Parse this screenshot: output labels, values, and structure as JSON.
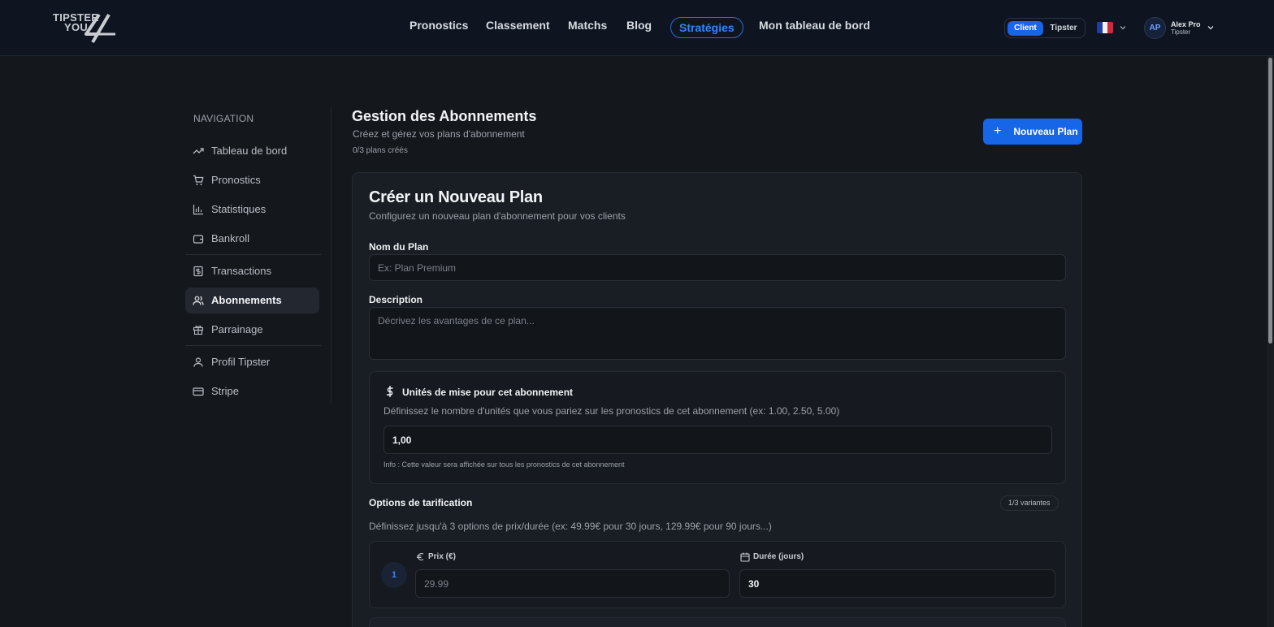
{
  "header": {
    "logo_line1": "TIPSTER",
    "logo_line2": "YOU",
    "nav": [
      "Pronostics",
      "Classement",
      "Matchs",
      "Blog",
      "Stratégies",
      "Mon tableau de bord"
    ],
    "active_nav": "Stratégies",
    "toggle": {
      "client": "Client",
      "tipster": "Tipster",
      "selected": "Client"
    },
    "language_flag": "fr",
    "user": {
      "initials": "AP",
      "name": "Alex Pro",
      "role": "Tipster"
    }
  },
  "sidebar": {
    "title": "NAVIGATION",
    "items": [
      {
        "label": "Tableau de bord",
        "icon": "trending-up-icon"
      },
      {
        "label": "Pronostics",
        "icon": "cart-icon"
      },
      {
        "label": "Statistiques",
        "icon": "bar-chart-icon"
      },
      {
        "label": "Bankroll",
        "icon": "wallet-icon"
      },
      {
        "label": "Transactions",
        "icon": "dollar-receipt-icon"
      },
      {
        "label": "Abonnements",
        "icon": "users-icon",
        "active": true
      },
      {
        "label": "Parrainage",
        "icon": "gift-icon"
      },
      {
        "label": "Profil Tipster",
        "icon": "user-icon"
      },
      {
        "label": "Stripe",
        "icon": "credit-card-icon"
      }
    ]
  },
  "main": {
    "title": "Gestion des Abonnements",
    "subtitle": "Créez et gérez vos plans d'abonnement",
    "count": "0/3 plans créés",
    "new_plan_button": "Nouveau Plan"
  },
  "form": {
    "title": "Créer un Nouveau Plan",
    "subtitle": "Configurez un nouveau plan d'abonnement pour vos clients",
    "name_label": "Nom du Plan",
    "name_placeholder": "Ex: Plan Premium",
    "description_label": "Description",
    "description_placeholder": "Décrivez les avantages de ce plan...",
    "units": {
      "title": "Unités de mise pour cet abonnement",
      "description": "Définissez le nombre d'unités que vous pariez sur les pronostics de cet abonnement (ex: 1.00, 2.50, 5.00)",
      "value": "1,00",
      "info": "Info : Cette valeur sera affichée sur tous les pronostics de cet abonnement"
    },
    "pricing": {
      "title": "Options de tarification",
      "badge": "1/3 variantes",
      "description": "Définissez jusqu'à 3 options de prix/durée (ex: 49.99€ pour 30 jours, 129.99€ pour 90 jours...)",
      "variants": [
        {
          "number": "1",
          "price_label": "Prix (€)",
          "price_placeholder": "29.99",
          "duration_label": "Durée (jours)",
          "duration_value": "30"
        }
      ]
    }
  },
  "colors": {
    "accent": "#1766e8",
    "background": "#14171c",
    "header": "#0e1521"
  }
}
